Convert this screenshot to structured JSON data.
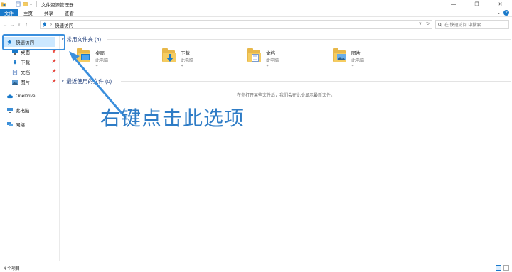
{
  "window": {
    "title": "文件资源管理器",
    "controls": [
      "—",
      "❐",
      "✕"
    ]
  },
  "ribbon": {
    "tabs": [
      "文件",
      "主页",
      "共享",
      "查看"
    ]
  },
  "address": {
    "path": "快速访问",
    "search_placeholder": "在 快速访问 中搜索"
  },
  "sidebar": {
    "quick_access": "快速访问",
    "items": [
      {
        "label": "桌面"
      },
      {
        "label": "下载"
      },
      {
        "label": "文档"
      },
      {
        "label": "图片"
      }
    ],
    "onedrive": "OneDrive",
    "this_pc": "此电脑",
    "network": "网络"
  },
  "content": {
    "frequent_header": "常用文件夹 (4)",
    "folders": [
      {
        "name": "桌面",
        "location": "此电脑"
      },
      {
        "name": "下载",
        "location": "此电脑"
      },
      {
        "name": "文档",
        "location": "此电脑"
      },
      {
        "name": "图片",
        "location": "此电脑"
      }
    ],
    "recent_header": "最近使用的文件 (0)",
    "empty_message": "在你打开某些文件后，我们会在此处显示最新文件。"
  },
  "annotation": {
    "text": "右键点击此选项",
    "color": "#2e7cc6"
  },
  "status": {
    "item_count": "4 个项目"
  },
  "colors": {
    "accent": "#1979ca",
    "selection": "#cce8ff",
    "folder": "#f5cc61"
  }
}
